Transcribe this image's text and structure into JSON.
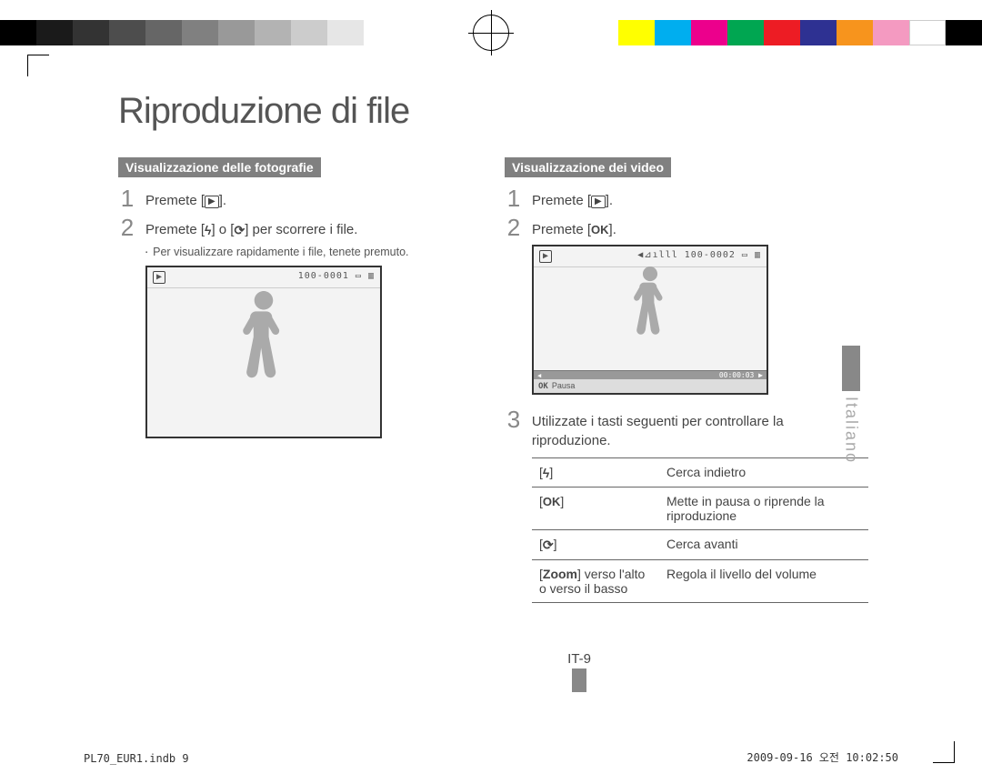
{
  "colorbar_left": [
    "#000000",
    "#1a1a1a",
    "#333333",
    "#4d4d4d",
    "#666666",
    "#808080",
    "#999999",
    "#b3b3b3",
    "#cccccc",
    "#e6e6e6"
  ],
  "colorbar_right": [
    "#ffff00",
    "#00aeef",
    "#ec008c",
    "#00a651",
    "#ed1c24",
    "#2e3192",
    "#f7941d",
    "#f49ac1",
    "#ffffff",
    "#000000"
  ],
  "title": "Riproduzione di file",
  "language_tab": "Italiano",
  "photo": {
    "section_label": "Visualizzazione delle fotografie",
    "step1": "Premete [",
    "step1_icon": "▶",
    "step1_end": "].",
    "step2_a": "Premete [",
    "step2_b": "] o [",
    "step2_c": "] per scorrere i file.",
    "step2_note": "Per visualizzare rapidamente i file, tenete premuto.",
    "frame_topleft_icon": "▶",
    "frame_topright": "100-0001 ▭ ▥"
  },
  "video": {
    "section_label": "Visualizzazione dei video",
    "step1": "Premete [",
    "step1_icon": "▶",
    "step1_end": "].",
    "step2": "Premete [",
    "step2_icon": "OK",
    "step2_end": "].",
    "frame_topleft_icon": "▶",
    "frame_topright": "◀⊿ılll 100-0002 ▭ ▥",
    "frame_time": "00:00:03",
    "frame_caption_key": "OK",
    "frame_caption_text": "Pausa",
    "step3": "Utilizzate i tasti seguenti per controllare la riproduzione.",
    "controls": [
      {
        "key_type": "flash",
        "desc": "Cerca indietro"
      },
      {
        "key_type": "ok",
        "desc": "Mette in pausa o riprende la riproduzione"
      },
      {
        "key_type": "timer",
        "desc": "Cerca avanti"
      },
      {
        "key_type": "zoom",
        "key_label_a": "Zoom",
        "key_label_b": " verso l'alto o verso il basso",
        "desc": "Regola il livello del volume"
      }
    ]
  },
  "page_number": "IT-9",
  "footer_left": "PL70_EUR1.indb   9",
  "footer_right": "2009-09-16   오전 10:02:50"
}
